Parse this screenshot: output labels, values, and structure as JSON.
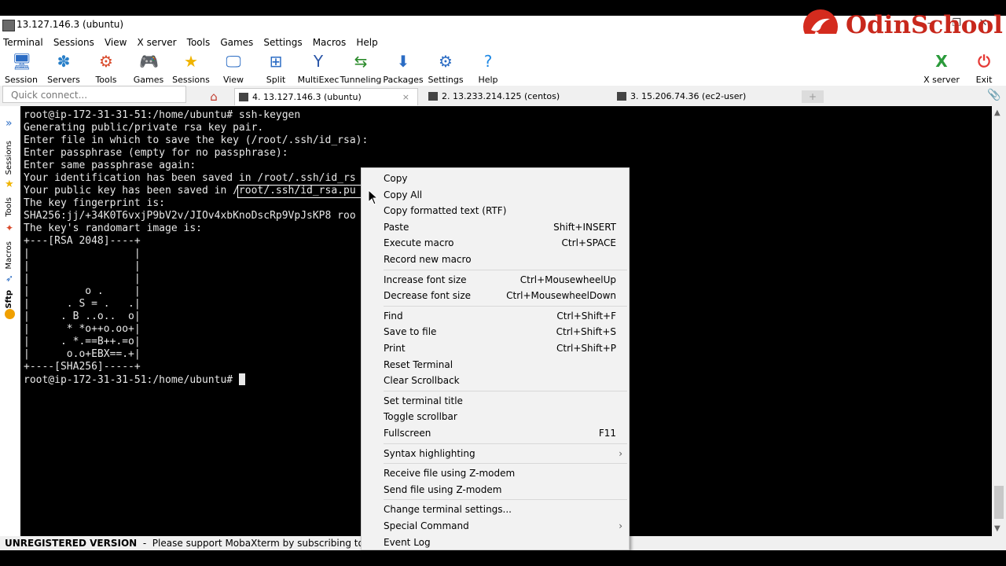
{
  "window": {
    "title": "13.127.146.3 (ubuntu)",
    "logo_text": "OdinSchool",
    "controls": [
      "–",
      "❐",
      "✕"
    ]
  },
  "menubar": [
    "Terminal",
    "Sessions",
    "View",
    "X server",
    "Tools",
    "Games",
    "Settings",
    "Macros",
    "Help"
  ],
  "toolbar": {
    "left": [
      {
        "label": "Session",
        "icon": "session-icon",
        "glyph": "🖥",
        "color": "#2b6cc4"
      },
      {
        "label": "Servers",
        "icon": "servers-icon",
        "glyph": "✽",
        "color": "#2a80c9"
      },
      {
        "label": "Tools",
        "icon": "tools-icon",
        "glyph": "⚙",
        "color": "#d94a2b"
      },
      {
        "label": "Games",
        "icon": "games-icon",
        "glyph": "🎮",
        "color": "#444"
      },
      {
        "label": "Sessions",
        "icon": "star-icon",
        "glyph": "★",
        "color": "#f0b400"
      },
      {
        "label": "View",
        "icon": "view-icon",
        "glyph": "🖵",
        "color": "#2b6cc4"
      },
      {
        "label": "Split",
        "icon": "split-icon",
        "glyph": "⊞",
        "color": "#2b6cc4"
      },
      {
        "label": "MultiExec",
        "icon": "multiexec-icon",
        "glyph": "Y",
        "color": "#2b56a8"
      },
      {
        "label": "Tunneling",
        "icon": "tunneling-icon",
        "glyph": "⇆",
        "color": "#2a8a2a"
      },
      {
        "label": "Packages",
        "icon": "packages-icon",
        "glyph": "⬇",
        "color": "#2b6cc4"
      },
      {
        "label": "Settings",
        "icon": "settings-gear-icon",
        "glyph": "⚙",
        "color": "#2b6cc4"
      },
      {
        "label": "Help",
        "icon": "help-icon",
        "glyph": "?",
        "color": "#1e88e5"
      }
    ],
    "right": [
      {
        "label": "X server",
        "icon": "xserver-icon",
        "glyph": "X",
        "color": "#2a9a3a"
      },
      {
        "label": "Exit",
        "icon": "power-icon",
        "glyph": "⏻",
        "color": "#e53935"
      }
    ]
  },
  "quick_connect": {
    "placeholder": "Quick connect..."
  },
  "tabs": [
    {
      "label": "4. 13.127.146.3 (ubuntu)",
      "active": true,
      "close": "×"
    },
    {
      "label": "2. 13.233.214.125 (centos)",
      "active": false
    },
    {
      "label": "3. 15.206.74.36 (ec2-user)",
      "active": false
    }
  ],
  "side_panel": [
    "Sessions",
    "Tools",
    "Macros",
    "Sftp"
  ],
  "terminal": {
    "lines": [
      "root@ip-172-31-31-51:/home/ubuntu# ssh-keygen",
      "Generating public/private rsa key pair.",
      "Enter file in which to save the key (/root/.ssh/id_rsa):",
      "Enter passphrase (empty for no passphrase):",
      "Enter same passphrase again:",
      "Your identification has been saved in /root/.ssh/id_rs",
      "Your public key has been saved in /root/.ssh/id_rsa.pu",
      "The key fingerprint is:",
      "SHA256:jj/+34K0T6vxjP9bV2v/JIOv4xbKnoDscRp9VpJsKP8 roo",
      "The key's randomart image is:",
      "+---[RSA 2048]----+",
      "|                 |",
      "|                 |",
      "|                 |",
      "|         o .     |",
      "|      . S = .   .|",
      "|     . B ..o..  o|",
      "|      * *o++o.oo+|",
      "|     . *.==B++.=o|",
      "|      o.o+EBX==.+|",
      "+----[SHA256]-----+",
      "root@ip-172-31-31-51:/home/ubuntu# "
    ]
  },
  "status_bar": {
    "bold": "UNREGISTERED VERSION",
    "text": "  -  Please support MobaXterm by subscribing to the pro"
  },
  "context_menu": {
    "groups": [
      [
        {
          "label": "Copy",
          "shortcut": ""
        },
        {
          "label": "Copy All",
          "shortcut": ""
        },
        {
          "label": "Copy formatted text (RTF)",
          "shortcut": ""
        },
        {
          "label": "Paste",
          "shortcut": "Shift+INSERT"
        },
        {
          "label": "Execute macro",
          "shortcut": "Ctrl+SPACE"
        },
        {
          "label": "Record new macro",
          "shortcut": ""
        }
      ],
      [
        {
          "label": "Increase font size",
          "shortcut": "Ctrl+MousewheelUp"
        },
        {
          "label": "Decrease font size",
          "shortcut": "Ctrl+MousewheelDown"
        }
      ],
      [
        {
          "label": "Find",
          "shortcut": "Ctrl+Shift+F"
        },
        {
          "label": "Save to file",
          "shortcut": "Ctrl+Shift+S"
        },
        {
          "label": "Print",
          "shortcut": "Ctrl+Shift+P"
        },
        {
          "label": "Reset Terminal",
          "shortcut": ""
        },
        {
          "label": "Clear Scrollback",
          "shortcut": ""
        }
      ],
      [
        {
          "label": "Set terminal title",
          "shortcut": ""
        },
        {
          "label": "Toggle scrollbar",
          "shortcut": ""
        },
        {
          "label": "Fullscreen",
          "shortcut": "F11"
        }
      ],
      [
        {
          "label": "Syntax highlighting",
          "shortcut": "›"
        }
      ],
      [
        {
          "label": "Receive file using Z-modem",
          "shortcut": ""
        },
        {
          "label": "Send file using Z-modem",
          "shortcut": ""
        }
      ],
      [
        {
          "label": "Change terminal settings...",
          "shortcut": ""
        },
        {
          "label": "Special Command",
          "shortcut": "›"
        },
        {
          "label": "Event Log",
          "shortcut": ""
        }
      ]
    ]
  }
}
